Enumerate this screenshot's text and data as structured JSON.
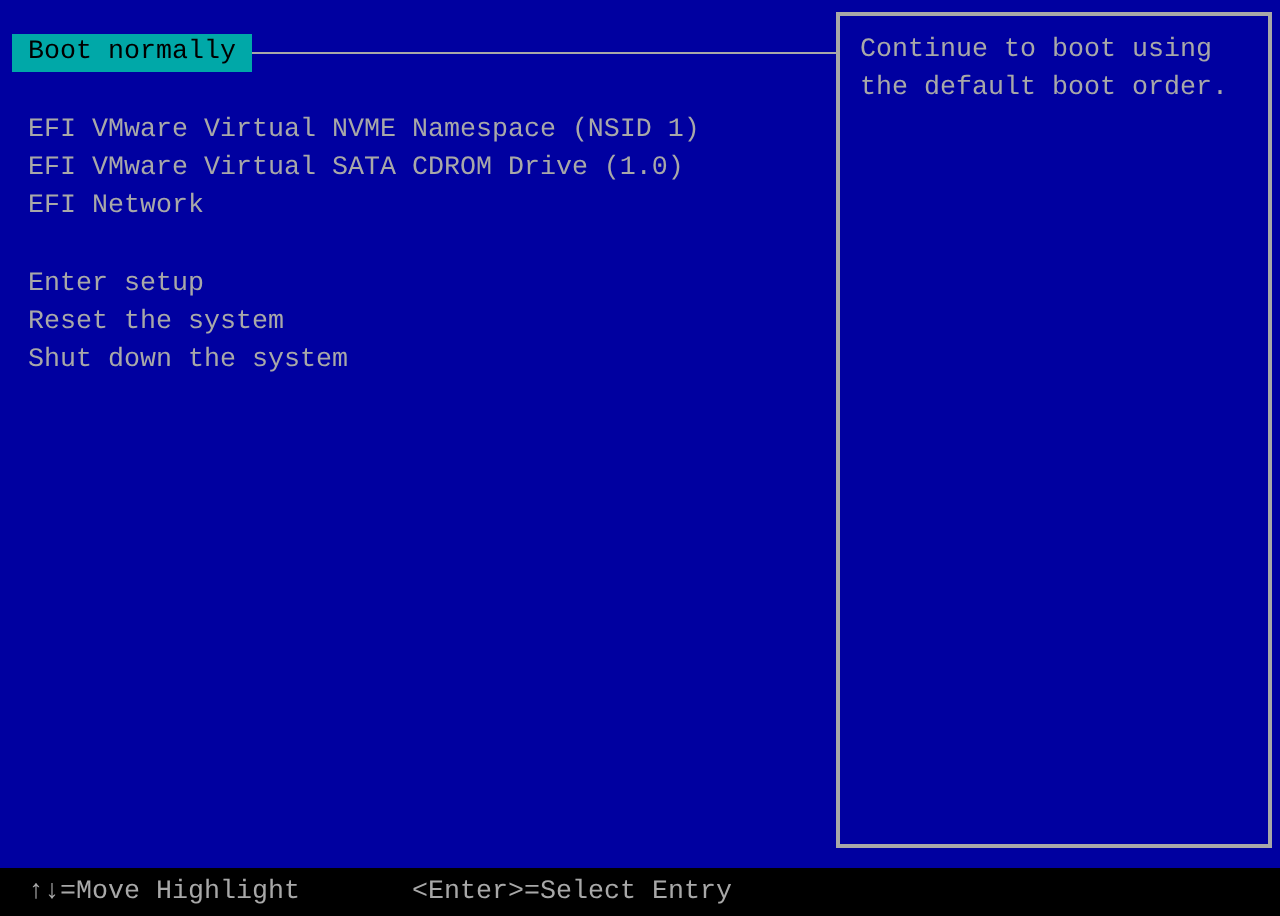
{
  "menu": {
    "groups": [
      {
        "items": [
          {
            "label": "Boot normally",
            "selected": true
          }
        ]
      },
      {
        "items": [
          {
            "label": "EFI VMware Virtual NVME Namespace (NSID 1)",
            "selected": false
          },
          {
            "label": "EFI VMware Virtual SATA CDROM Drive (1.0)",
            "selected": false
          },
          {
            "label": "EFI Network",
            "selected": false
          }
        ]
      },
      {
        "items": [
          {
            "label": "Enter setup",
            "selected": false
          },
          {
            "label": "Reset the system",
            "selected": false
          },
          {
            "label": "Shut down the system",
            "selected": false
          }
        ]
      }
    ]
  },
  "help_panel": {
    "text": "Continue to boot using the default boot order."
  },
  "status_bar": [
    "↑↓=Move Highlight",
    "<Enter>=Select Entry"
  ]
}
